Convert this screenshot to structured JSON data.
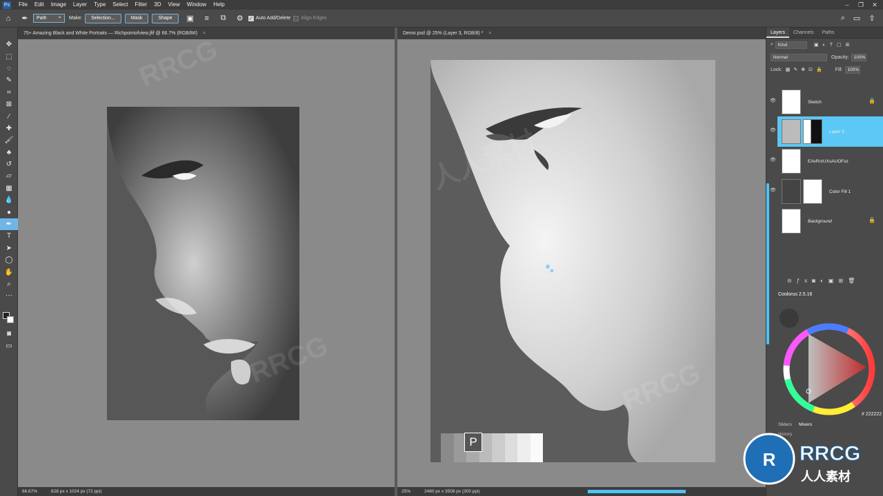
{
  "menubar": {
    "items": [
      "File",
      "Edit",
      "Image",
      "Layer",
      "Type",
      "Select",
      "Filter",
      "3D",
      "View",
      "Window",
      "Help"
    ]
  },
  "options": {
    "mode_value": "Path",
    "make_label": "Make:",
    "selection_btn": "Selection...",
    "mask_btn": "Mask",
    "shape_btn": "Shape",
    "auto_add_delete": "Auto Add/Delete",
    "align_edges": "Align Edges"
  },
  "doc_left": {
    "tab_title": "75+ Amazing Black and White Portraits — Richpointofview.jfif @ 66.7% (RGB/8#)",
    "zoom": "66.67%",
    "size": "628 px x 1024 px (72 ppi)"
  },
  "doc_right": {
    "tab_title": "Demo.psd @ 25% (Layer 3, RGB/8) *",
    "zoom": "25%",
    "size": "2480 px x 3508 px (300 ppi)",
    "badge": "P"
  },
  "layers_panel": {
    "tabs": [
      "Layers",
      "Channels",
      "Paths"
    ],
    "kind_label": "Kind",
    "blend_mode": "Normal",
    "opacity_label": "Opacity:",
    "opacity_value": "100%",
    "lock_label": "Lock:",
    "fill_label": "Fill:",
    "fill_value": "100%",
    "layers": [
      {
        "name": "Sketch",
        "locked": true
      },
      {
        "name": "Layer 3",
        "selected": true
      },
      {
        "name": "EAvRrzUXsAUOFsz"
      },
      {
        "name": "Color Fill 1"
      },
      {
        "name": "Background",
        "locked": true
      }
    ]
  },
  "coolorus": {
    "title": "Coolorus 2.5.16",
    "hex": "# 222222",
    "bottom_tabs": [
      "Sliders",
      "Mixers"
    ],
    "history_label": "History"
  },
  "watermark": {
    "text_latin": "RRCG",
    "text_cn": "人人素材",
    "logo_text": "RRCG",
    "logo_sub": "人人素材"
  },
  "colors": {
    "accent": "#5bc8f5",
    "foreground": "#222222",
    "panel_bg": "#4a4a4a"
  }
}
